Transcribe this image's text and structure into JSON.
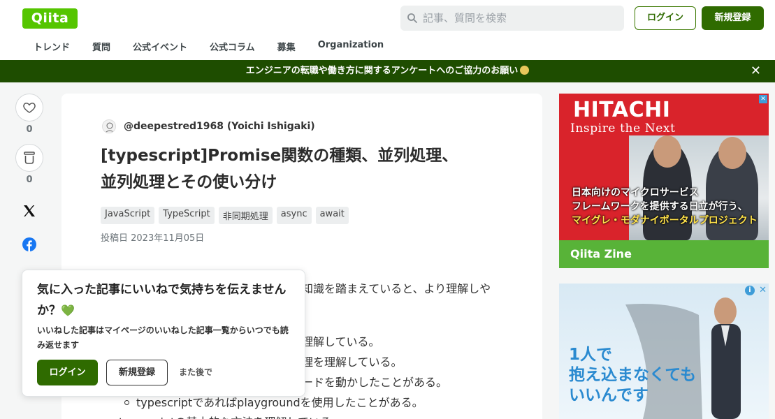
{
  "header": {
    "logo": "Qiita",
    "search_placeholder": "記事、質問を検索",
    "login_label": "ログイン",
    "signup_label": "新規登録",
    "nav": [
      "トレンド",
      "質問",
      "公式イベント",
      "公式コラム",
      "募集",
      "Organization"
    ]
  },
  "banner": {
    "text": "エンジニアの転職や働き方に関するアンケートへのご協力のお願い",
    "close": "✕"
  },
  "actions": {
    "like_count": "0",
    "stock_count": "0"
  },
  "article": {
    "author": "@deepestred1968 (Yoichi Ishigaki)",
    "title_line1": "[typescript]Promise関数の種類、並列処理、",
    "title_line2": "並列処理とその使い分け",
    "tags": [
      "JavaScript",
      "TypeScript",
      "非同期処理",
      "async",
      "await"
    ],
    "posted": "投稿日 2023年11月05日",
    "body": {
      "line1": "知識を踏まえていると、より理解しや",
      "line2": "理解している。",
      "line3": "理を理解している。",
      "line4": "ードを動かしたことがある。",
      "line5": "typescriptであればplaygroundを使用したことがある。",
      "line6": "typescriptの基本的な文法を理解している"
    }
  },
  "ads": {
    "ad1": {
      "brand": "HITACHI",
      "tagline": "Inspire the Next",
      "copy_line1": "日本向けのマイクロサービス",
      "copy_line2": "フレームワークを提供する日立が行う、",
      "copy_line3": "マイグレ・モダナイポータルプロジェクト",
      "footer": "Qiita Zine"
    },
    "ad2": {
      "copy_line1": "1人で",
      "copy_line2": "抱え込まなくても",
      "copy_line3": "いいんです"
    }
  },
  "popup": {
    "title": "気に入った記事にいいねで気持ちを伝えませんか？",
    "heart": "💚",
    "desc": "いいねした記事はマイページのいいねした記事一覧からいつでも読み返せます",
    "login_label": "ログイン",
    "signup_label": "新規登録",
    "later_label": "また後で"
  }
}
